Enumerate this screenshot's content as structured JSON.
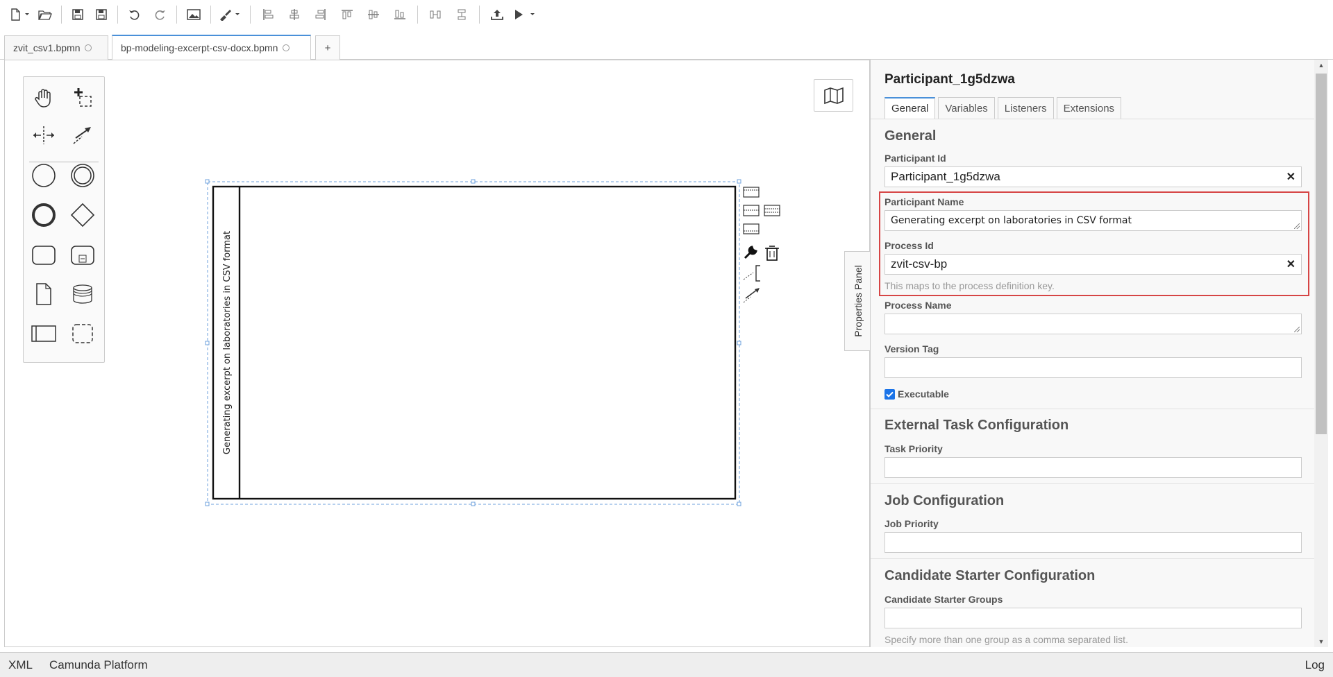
{
  "toolbar": {
    "buttons": [
      "new-file-icon",
      "open-file-icon",
      "save-icon",
      "save-as-icon",
      "undo-icon",
      "redo-icon",
      "image-export-icon",
      "color-picker-icon",
      "align-left-icon",
      "align-center-icon",
      "align-right-icon",
      "align-top-icon",
      "align-middle-icon",
      "align-bottom-icon",
      "distribute-horizontal-icon",
      "distribute-vertical-icon",
      "deploy-icon",
      "run-icon"
    ]
  },
  "tabs": [
    {
      "label": "zvit_csv1.bpmn",
      "active": false
    },
    {
      "label": "bp-modeling-excerpt-csv-docx.bpmn",
      "active": true
    }
  ],
  "tab_add": "+",
  "canvas": {
    "pool_name": "Generating excerpt on laboratories in CSV format"
  },
  "properties_toggle": "Properties Panel",
  "panel": {
    "title": "Participant_1g5dzwa",
    "tabs": [
      "General",
      "Variables",
      "Listeners",
      "Extensions"
    ],
    "active_tab": "General",
    "general": {
      "heading": "General",
      "participant_id_label": "Participant Id",
      "participant_id_value": "Participant_1g5dzwa",
      "participant_name_label": "Participant Name",
      "participant_name_value": "Generating excerpt on laboratories in CSV format",
      "process_id_label": "Process Id",
      "process_id_value": "zvit-csv-bp",
      "process_id_hint": "This maps to the process definition key.",
      "process_name_label": "Process Name",
      "process_name_value": "",
      "version_tag_label": "Version Tag",
      "version_tag_value": "",
      "executable_label": "Executable",
      "executable_checked": true
    },
    "external_task": {
      "heading": "External Task Configuration",
      "task_priority_label": "Task Priority",
      "task_priority_value": ""
    },
    "job": {
      "heading": "Job Configuration",
      "job_priority_label": "Job Priority",
      "job_priority_value": ""
    },
    "candidate": {
      "heading": "Candidate Starter Configuration",
      "groups_label": "Candidate Starter Groups",
      "groups_value": "",
      "groups_hint": "Specify more than one group as a comma separated list."
    }
  },
  "status": {
    "xml": "XML",
    "platform": "Camunda Platform",
    "log": "Log"
  },
  "colors": {
    "accent": "#4a90d9",
    "highlight": "#d64545",
    "checkbox": "#1a73e8"
  }
}
